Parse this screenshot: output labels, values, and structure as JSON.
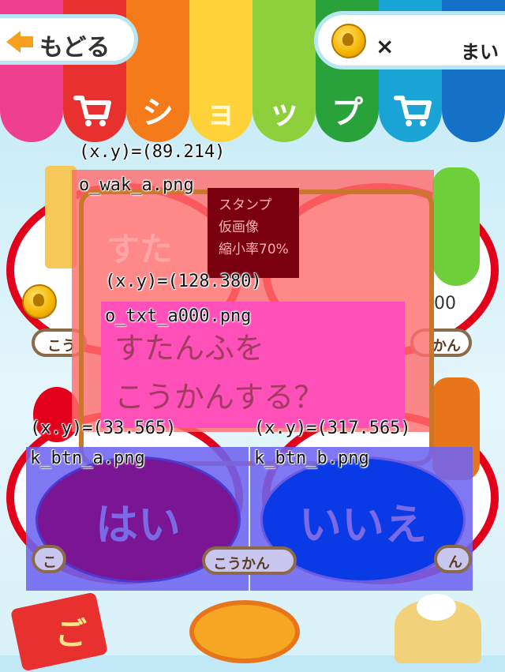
{
  "header": {
    "back_label": "もどる",
    "title_chars": [
      "シ",
      "ョ",
      "ッ",
      "プ"
    ],
    "coin_times": "×",
    "coin_unit": "まい",
    "stripe_colors": [
      "#ef3f8f",
      "#e8302f",
      "#f47a1a",
      "#ffd23a",
      "#8ccf3a",
      "#2aa23c",
      "#1aa4d6",
      "#1570c8"
    ]
  },
  "cards": {
    "price_partial_right": "00",
    "buy_left": "こう",
    "buy_right": "かん",
    "buy_mid": "こうかん",
    "buy_left_lower": "こ",
    "buy_right_lower": "ん"
  },
  "dialog": {
    "frame_coord": "(x.y)=(89.214)",
    "frame_file": "o_wak_a.png",
    "ghost_title": "すた",
    "stamp_info": [
      "スタンプ",
      "仮画像",
      "縮小率70%"
    ],
    "text_coord": "(x.y)=(128.380)",
    "text_file": "o_txt_a000.png",
    "question_line1": "すたんふを",
    "question_line2": "こうかんする？"
  },
  "buttons": {
    "yes_coord": "(x.y)=(33.565)",
    "yes_file": "k_btn_a.png",
    "yes_label": "はい",
    "no_coord": "(x.y)=(317.565)",
    "no_file": "k_btn_b.png",
    "no_label": "いいえ"
  },
  "bottom_partial_char": "ご",
  "colors": {
    "yes_fill": "#7a1593",
    "no_fill": "#0a3ae6",
    "label_fill": "#7a6ae8",
    "card_border": "#e3001b"
  }
}
